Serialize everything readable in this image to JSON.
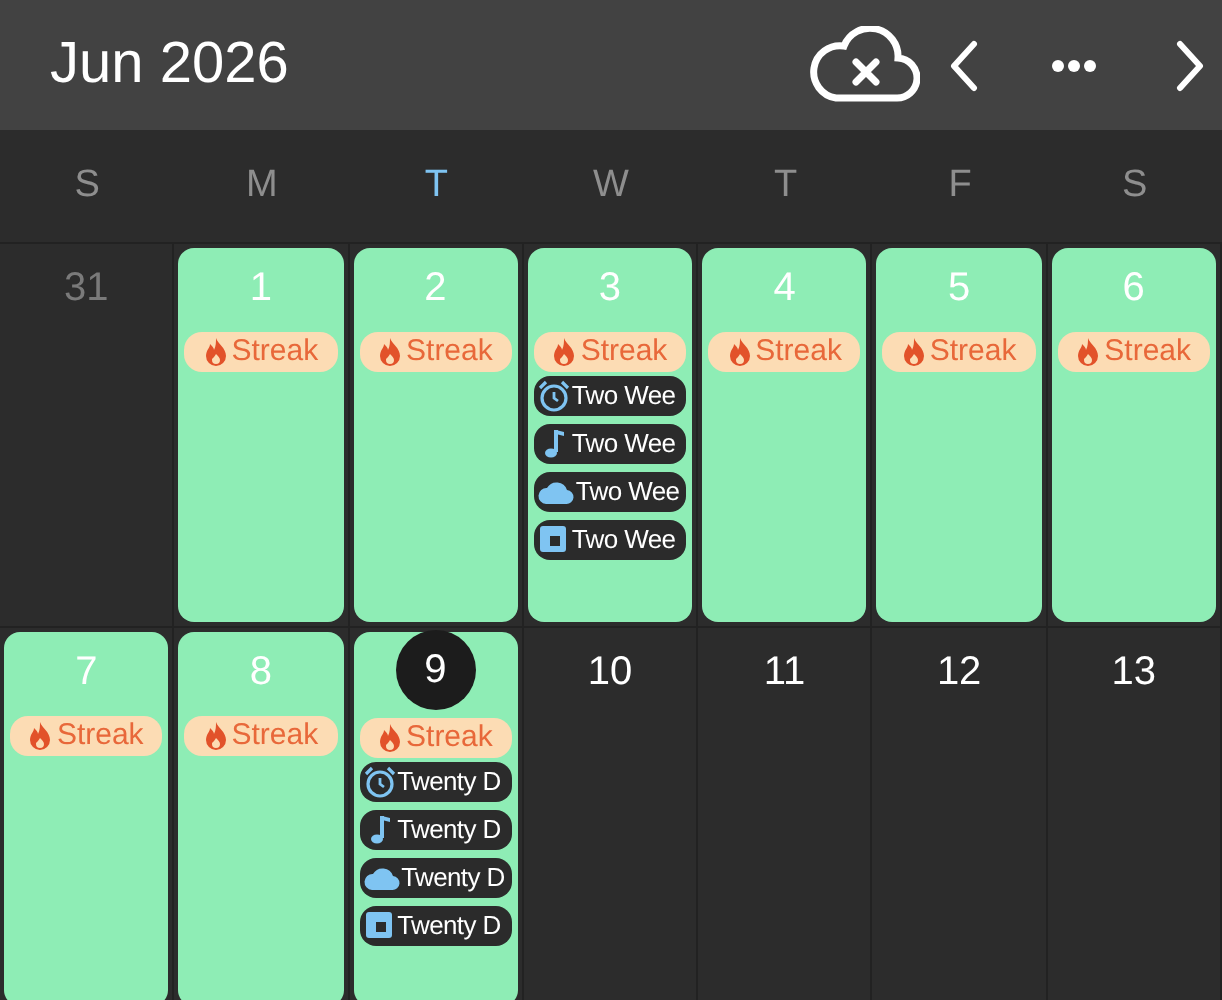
{
  "header": {
    "title": "Jun 2026"
  },
  "weekdays": [
    {
      "label": "S",
      "selected": false
    },
    {
      "label": "M",
      "selected": false
    },
    {
      "label": "T",
      "selected": true
    },
    {
      "label": "W",
      "selected": false
    },
    {
      "label": "T",
      "selected": false
    },
    {
      "label": "F",
      "selected": false
    },
    {
      "label": "S",
      "selected": false
    }
  ],
  "days": [
    {
      "number": "31",
      "in_month": false,
      "completed": false,
      "today": false
    },
    {
      "number": "1",
      "in_month": true,
      "completed": true,
      "today": false,
      "streak": "Streak"
    },
    {
      "number": "2",
      "in_month": true,
      "completed": true,
      "today": false,
      "streak": "Streak"
    },
    {
      "number": "3",
      "in_month": true,
      "completed": true,
      "today": false,
      "streak": "Streak",
      "events": [
        {
          "kind": "alarm",
          "title": "Two Wee"
        },
        {
          "kind": "music",
          "title": "Two Wee"
        },
        {
          "kind": "cloud",
          "title": "Two Wee"
        },
        {
          "kind": "square",
          "title": "Two Wee"
        }
      ]
    },
    {
      "number": "4",
      "in_month": true,
      "completed": true,
      "today": false,
      "streak": "Streak"
    },
    {
      "number": "5",
      "in_month": true,
      "completed": true,
      "today": false,
      "streak": "Streak"
    },
    {
      "number": "6",
      "in_month": true,
      "completed": true,
      "today": false,
      "streak": "Streak"
    },
    {
      "number": "7",
      "in_month": true,
      "completed": true,
      "today": false,
      "streak": "Streak"
    },
    {
      "number": "8",
      "in_month": true,
      "completed": true,
      "today": false,
      "streak": "Streak"
    },
    {
      "number": "9",
      "in_month": true,
      "completed": true,
      "today": true,
      "streak": "Streak",
      "events": [
        {
          "kind": "alarm",
          "title": "Twenty D"
        },
        {
          "kind": "music",
          "title": "Twenty D"
        },
        {
          "kind": "cloud",
          "title": "Twenty D"
        },
        {
          "kind": "square",
          "title": "Twenty D"
        }
      ]
    },
    {
      "number": "10",
      "in_month": true,
      "completed": false,
      "today": false
    },
    {
      "number": "11",
      "in_month": true,
      "completed": false,
      "today": false
    },
    {
      "number": "12",
      "in_month": true,
      "completed": false,
      "today": false
    },
    {
      "number": "13",
      "in_month": true,
      "completed": false,
      "today": false
    }
  ]
}
